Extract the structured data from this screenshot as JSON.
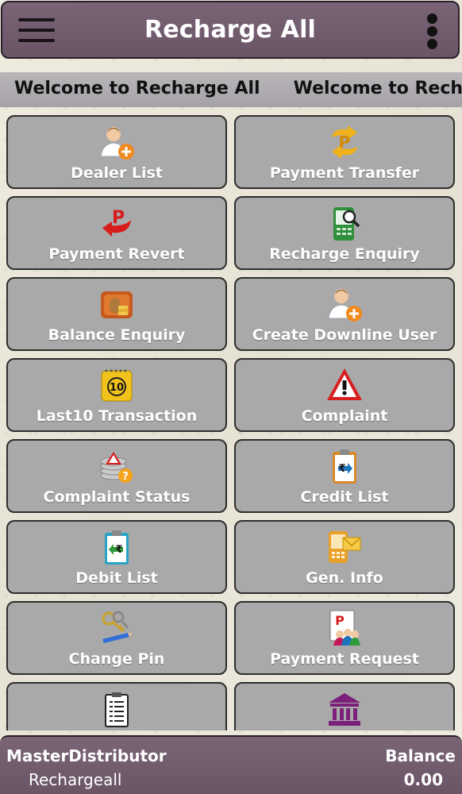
{
  "app_bar": {
    "title": "Recharge All",
    "menu_icon": "hamburger-icon",
    "more_icon": "more-vertical-icon"
  },
  "marquee": {
    "text": "Welcome to Recharge All",
    "text_repeat": "Welcome to Recharge A"
  },
  "tiles": [
    {
      "label": "Dealer List",
      "icon": "add-user-icon"
    },
    {
      "label": "Payment Transfer",
      "icon": "payment-transfer-icon"
    },
    {
      "label": "Payment Revert",
      "icon": "payment-revert-icon"
    },
    {
      "label": "Recharge Enquiry",
      "icon": "mobile-search-icon"
    },
    {
      "label": "Balance Enquiry",
      "icon": "money-bag-icon"
    },
    {
      "label": "Create Downline User",
      "icon": "add-user-icon"
    },
    {
      "label": "Last10 Transaction",
      "icon": "calendar-ten-icon"
    },
    {
      "label": "Complaint",
      "icon": "warning-icon"
    },
    {
      "label": "Complaint Status",
      "icon": "complaint-status-icon"
    },
    {
      "label": "Credit List",
      "icon": "credit-list-icon"
    },
    {
      "label": "Debit List",
      "icon": "debit-list-icon"
    },
    {
      "label": "Gen. Info",
      "icon": "info-message-icon"
    },
    {
      "label": "Change Pin",
      "icon": "keys-pen-icon"
    },
    {
      "label": "Payment Request",
      "icon": "payment-request-icon"
    },
    {
      "label": "",
      "icon": "document-list-icon"
    },
    {
      "label": "",
      "icon": "bank-icon"
    }
  ],
  "footer": {
    "role": "MasterDistributor",
    "username": "Rechargeall",
    "balance_label": "Balance",
    "balance_value": "0.00"
  },
  "colors": {
    "bar": "#6f5a6c",
    "tile": "#a9a9a9",
    "marquee": "#aeabaf"
  }
}
